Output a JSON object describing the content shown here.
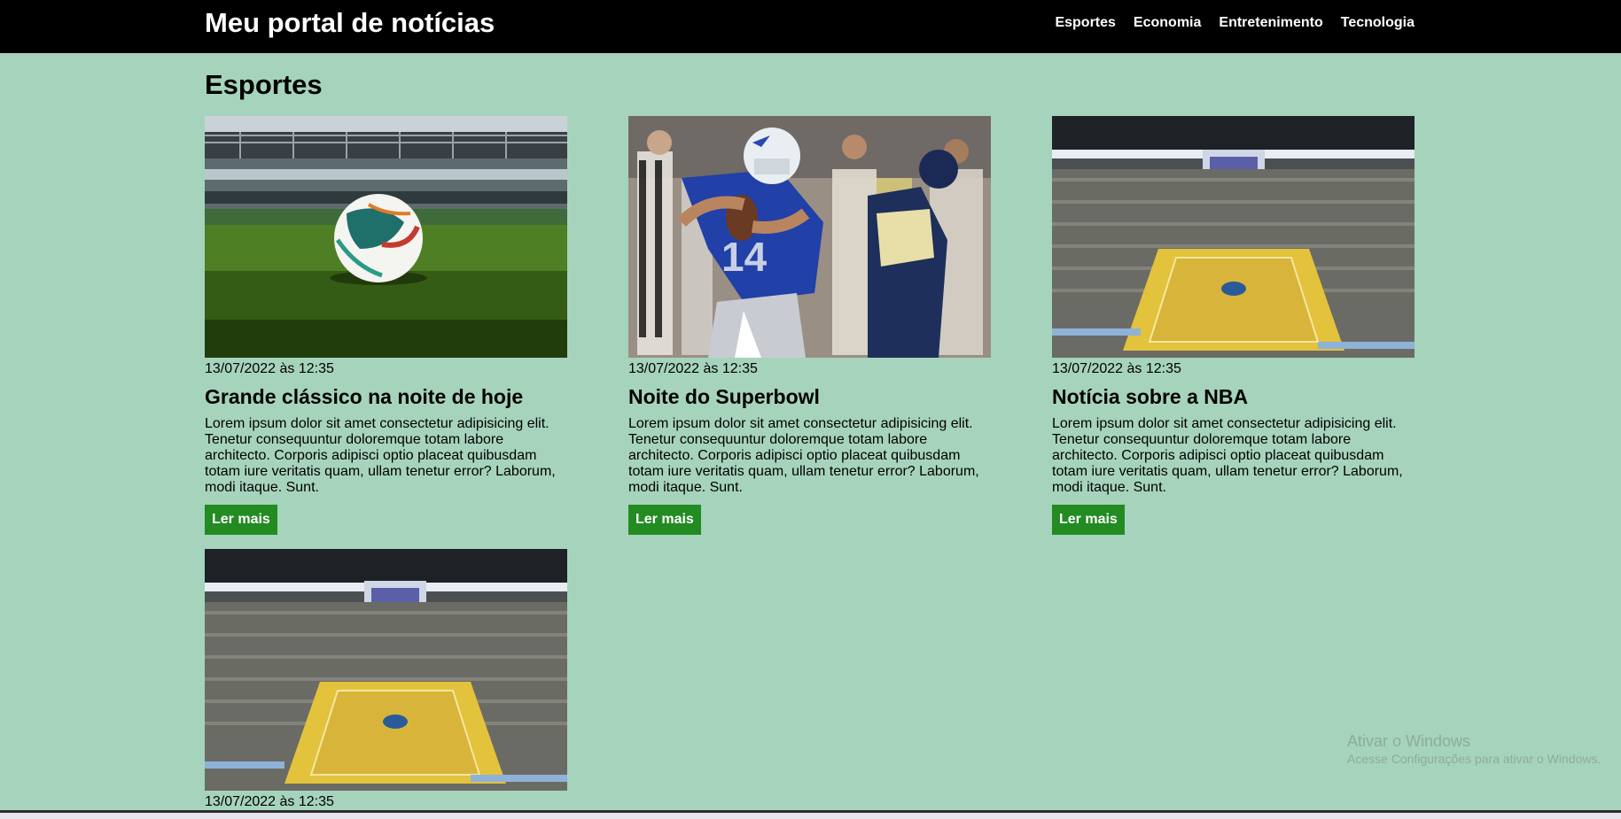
{
  "header": {
    "site_title": "Meu portal de notícias",
    "nav": [
      "Esportes",
      "Economia",
      "Entretenimento",
      "Tecnologia"
    ]
  },
  "section": {
    "title": "Esportes"
  },
  "articles": [
    {
      "image": "soccer-ball-stadium-photo",
      "date": "13/07/2022 às 12:35",
      "title": "Grande clássico na noite de hoje",
      "body": "Lorem ipsum dolor sit amet consectetur adipisicing elit. Tenetur consequuntur doloremque totam labore architecto. Corporis adipisci optio placeat quibusdam totam iure veritatis quam, ullam tenetur error? Laborum, modi itaque. Sunt.",
      "button": "Ler mais"
    },
    {
      "image": "american-football-player-photo",
      "date": "13/07/2022 às 12:35",
      "title": "Noite do Superbowl",
      "body": "Lorem ipsum dolor sit amet consectetur adipisicing elit. Tenetur consequuntur doloremque totam labore architecto. Corporis adipisci optio placeat quibusdam totam iure veritatis quam, ullam tenetur error? Laborum, modi itaque. Sunt.",
      "button": "Ler mais"
    },
    {
      "image": "basketball-arena-photo",
      "date": "13/07/2022 às 12:35",
      "title": "Notícia sobre a NBA",
      "body": "Lorem ipsum dolor sit amet consectetur adipisicing elit. Tenetur consequuntur doloremque totam labore architecto. Corporis adipisci optio placeat quibusdam totam iure veritatis quam, ullam tenetur error? Laborum, modi itaque. Sunt.",
      "button": "Ler mais"
    },
    {
      "image": "basketball-arena-photo",
      "date": "13/07/2022 às 12:35"
    }
  ],
  "watermark": {
    "line1": "Ativar o Windows",
    "line2": "Acesse Configurações para ativar o Windows."
  },
  "colors": {
    "page_bg": "#a6d3bc",
    "header_bg": "#000000",
    "button_bg": "#228b22"
  }
}
